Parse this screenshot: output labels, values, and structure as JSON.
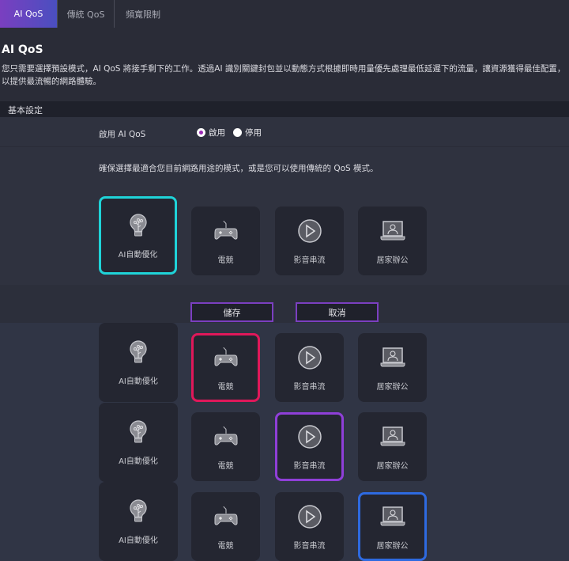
{
  "tabs": [
    {
      "label": "AI QoS",
      "active": true
    },
    {
      "label": "傳統 QoS"
    },
    {
      "label": "頻寬限制"
    }
  ],
  "title": "AI QoS",
  "description": "您只需要選擇預設模式，AI QoS 將接手剩下的工作。透過AI 識別關鍵封包並以動態方式根據即時用量優先處理最低延遲下的流量，讓資源獲得最佳配置，以提供最流暢的網路體驗。",
  "section_header": "基本設定",
  "enable": {
    "label": "啟用 AI QoS",
    "on": "啟用",
    "off": "停用",
    "selected": "on"
  },
  "hint": "確保選擇最適合您目前網路用途的模式，或是您可以使用傳統的 QoS 模式。",
  "modes": [
    {
      "label": "AI自動優化",
      "icon": "lightbulb-icon"
    },
    {
      "label": "電競",
      "icon": "gamepad-icon"
    },
    {
      "label": "影音串流",
      "icon": "play-icon"
    },
    {
      "label": "居家辦公",
      "icon": "laptop-user-icon"
    }
  ],
  "colors": {
    "ai": "#1fd3d8",
    "gaming": "#e0185a",
    "streaming": "#8f3fd8",
    "home": "#2e6ae0"
  },
  "buttons": {
    "save": "儲存",
    "cancel": "取消"
  }
}
